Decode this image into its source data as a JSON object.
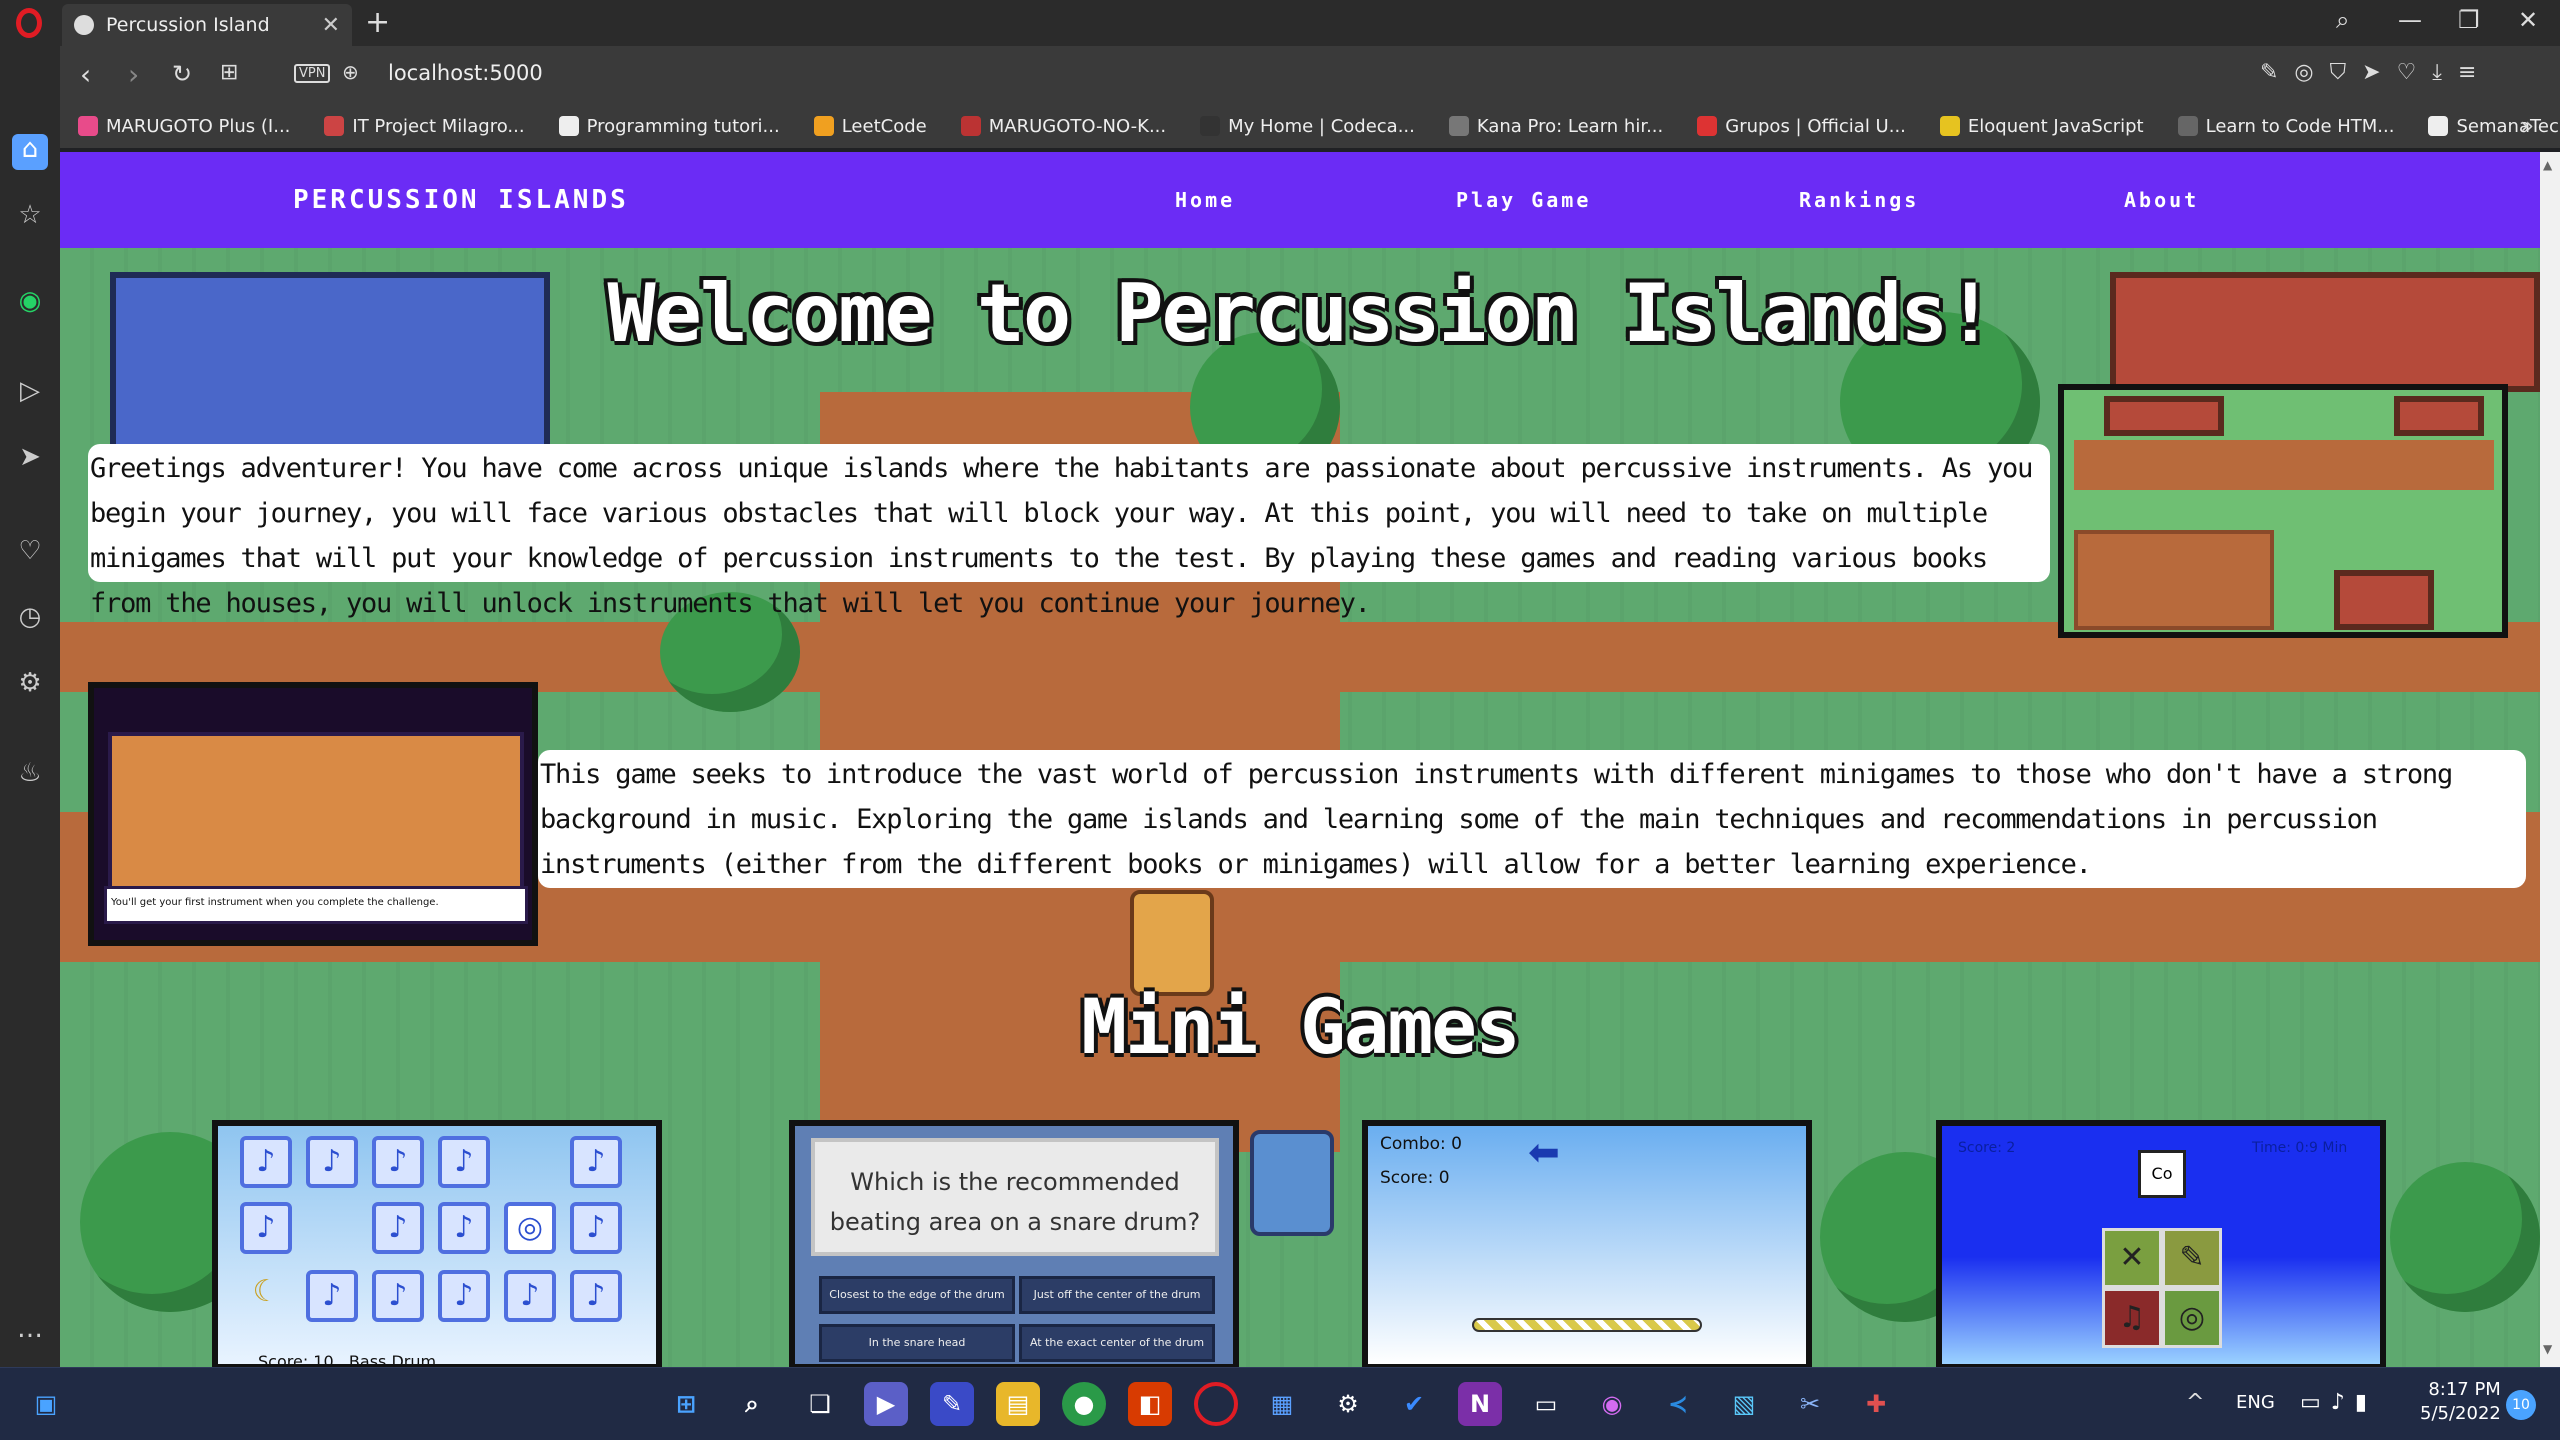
{
  "browser": {
    "tab_title": "Percussion Island",
    "url": "localhost:5000",
    "vpn_label": "VPN",
    "bookmarks": [
      "MARUGOTO Plus (I...",
      "IT Project Milagro...",
      "Programming tutori...",
      "LeetCode",
      "MARUGOTO-NO-K...",
      "My Home | Codeca...",
      "Kana Pro: Learn hir...",
      "Grupos | Official U...",
      "Eloquent JavaScript",
      "Learn to Code HTM...",
      "SemanaTec"
    ]
  },
  "nav": {
    "brand": "PERCUSSION ISLANDS",
    "links": [
      "Home",
      "Play Game",
      "Rankings",
      "About"
    ]
  },
  "main": {
    "title": "Welcome to Percussion Islands!",
    "intro": "Greetings adventurer! You have come across unique islands where the habitants are passionate about percussive instruments. As you begin your journey, you will face various obstacles that will block your way. At this point, you will need to take on multiple minigames that will put your knowledge of percussion instruments to the test. By playing these games and reading various books from the houses, you will unlock instruments that will let you continue your journey.",
    "about": "This game seeks to introduce the vast world of percussion instruments with different minigames to those who don't have a strong background in music. Exploring the game islands and learning some of the main techniques and recommendations in percussion instruments (either from the different books or minigames) will allow for a better learning experience.",
    "screenshot_caption": "You'll get your first instrument when you complete the challenge.",
    "minigames_title": "Mini Games"
  },
  "cards": {
    "memory": {
      "score_label": "Score:",
      "score": "10",
      "instrument": "Bass Drum"
    },
    "quiz": {
      "question": "Which is the recommended beating area on a snare drum?",
      "options": [
        "Closest to the edge of the drum",
        "Just off the center of the drum",
        "In the snare head",
        "At the exact center of the drum"
      ]
    },
    "rhythm": {
      "combo": "Combo: 0",
      "score": "Score: 0"
    },
    "match": {
      "score": "Score: 2",
      "time": "Time: 0:9 Min",
      "tile": "Co"
    }
  },
  "taskbar": {
    "lang": "ENG",
    "time": "8:17 PM",
    "date": "5/5/2022",
    "badge": "10"
  }
}
